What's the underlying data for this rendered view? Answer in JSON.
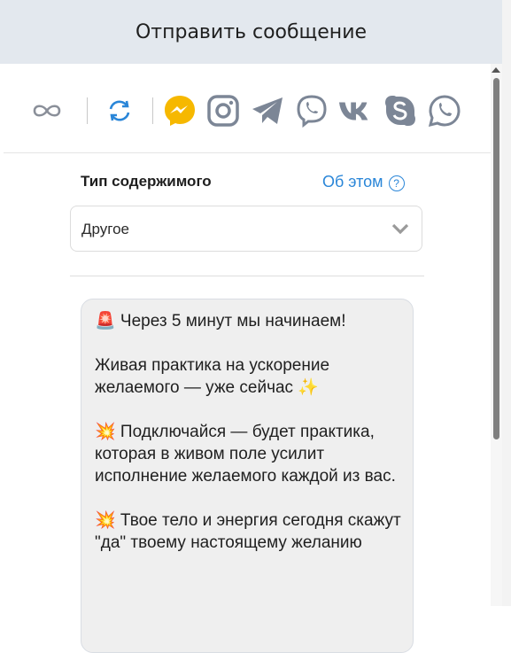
{
  "header": {
    "title": "Отправить сообщение"
  },
  "channels": [
    {
      "icon": "infinity-icon",
      "color": "#8a8f99"
    },
    {
      "icon": "refresh-icon",
      "color": "#2a86d8"
    },
    {
      "icon": "messenger-icon",
      "color": "#f6b800"
    },
    {
      "icon": "instagram-icon",
      "color": "#7c8696"
    },
    {
      "icon": "telegram-icon",
      "color": "#7c8696"
    },
    {
      "icon": "viber-icon",
      "color": "#7c8696"
    },
    {
      "icon": "vk-icon",
      "color": "#7c8696"
    },
    {
      "icon": "skype-icon",
      "color": "#7c8696"
    },
    {
      "icon": "whatsapp-icon",
      "color": "#7c8696"
    }
  ],
  "content_type": {
    "label": "Тип содержимого",
    "about_label": "Об этом",
    "help_glyph": "?",
    "selected": "Другое"
  },
  "message": {
    "text": "🚨 Через 5 минут мы начинаем!\n\nЖивая практика на ускорение желаемого — уже сейчас ✨\n\n💥 Подключайся — будет практика, которая в живом поле усилит исполнение желаемого каждой из вас.\n\n💥 Твое тело и энергия сегодня скажут \"да\" твоему настоящему желанию"
  }
}
